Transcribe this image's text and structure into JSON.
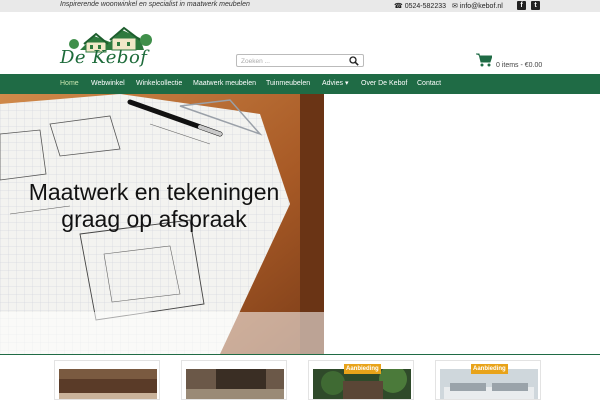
{
  "topbar": {
    "tagline": "Inspirerende woonwinkel en specialist in maatwerk meubelen",
    "phone": "0524-582233",
    "email": "info@kebof.nl"
  },
  "logo": {
    "text": "De Kebof"
  },
  "search": {
    "placeholder": "Zoeken ..."
  },
  "cart": {
    "summary": "0 items - €0.00"
  },
  "nav": {
    "items": [
      {
        "label": "Home",
        "active": true
      },
      {
        "label": "Webwinkel"
      },
      {
        "label": "Winkelcollectie"
      },
      {
        "label": "Maatwerk meubelen"
      },
      {
        "label": "Tuinmeubelen"
      },
      {
        "label": "Advies ▾"
      },
      {
        "label": "Over De Kebof"
      },
      {
        "label": "Contact"
      }
    ]
  },
  "hero": {
    "line1": "Maatwerk en tekeningen",
    "line2": "graag op afspraak"
  },
  "products": [
    {
      "badge": ""
    },
    {
      "badge": ""
    },
    {
      "badge": "Aanbieding"
    },
    {
      "badge": "Aanbieding"
    }
  ],
  "colors": {
    "brand_green": "#1f6b45",
    "badge_orange": "#e8a31a"
  }
}
